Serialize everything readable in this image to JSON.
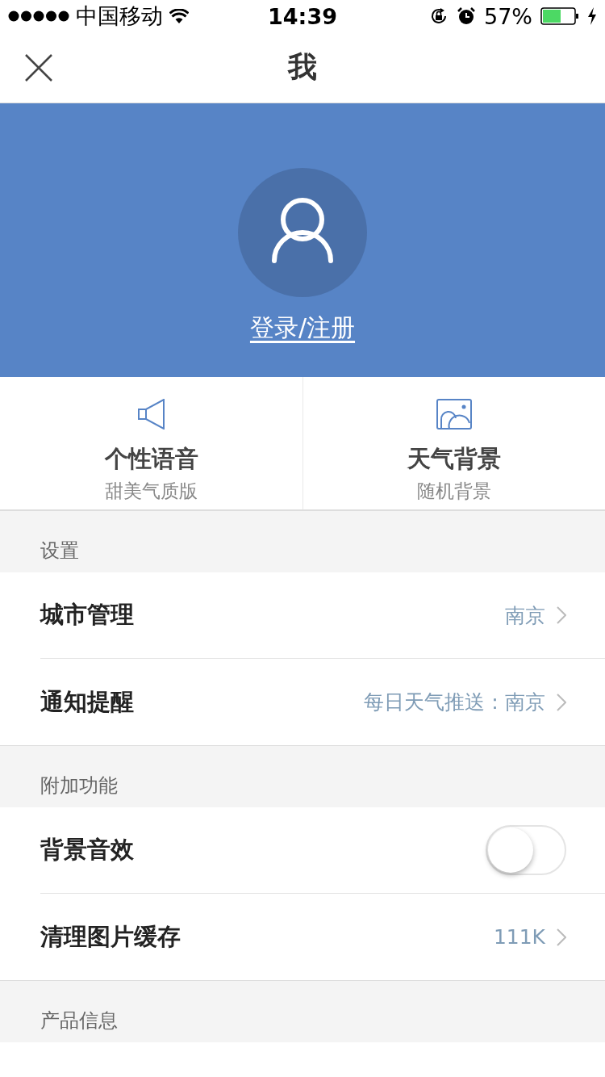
{
  "status_bar": {
    "carrier": "中国移动",
    "time": "14:39",
    "battery": "57%"
  },
  "nav": {
    "title": "我"
  },
  "profile": {
    "login_link": "登录/注册"
  },
  "features": [
    {
      "kind": "voice",
      "title": "个性语音",
      "subtitle": "甜美气质版"
    },
    {
      "kind": "background",
      "title": "天气背景",
      "subtitle": "随机背景"
    }
  ],
  "sections": [
    {
      "header": "设置",
      "rows": [
        {
          "kind": "link",
          "label": "城市管理",
          "value": "南京"
        },
        {
          "kind": "link",
          "label": "通知提醒",
          "value": "每日天气推送：南京"
        }
      ]
    },
    {
      "header": "附加功能",
      "rows": [
        {
          "kind": "toggle",
          "label": "背景音效",
          "on": false
        },
        {
          "kind": "link",
          "label": "清理图片缓存",
          "value": "111K"
        }
      ]
    },
    {
      "header": "产品信息"
    }
  ]
}
